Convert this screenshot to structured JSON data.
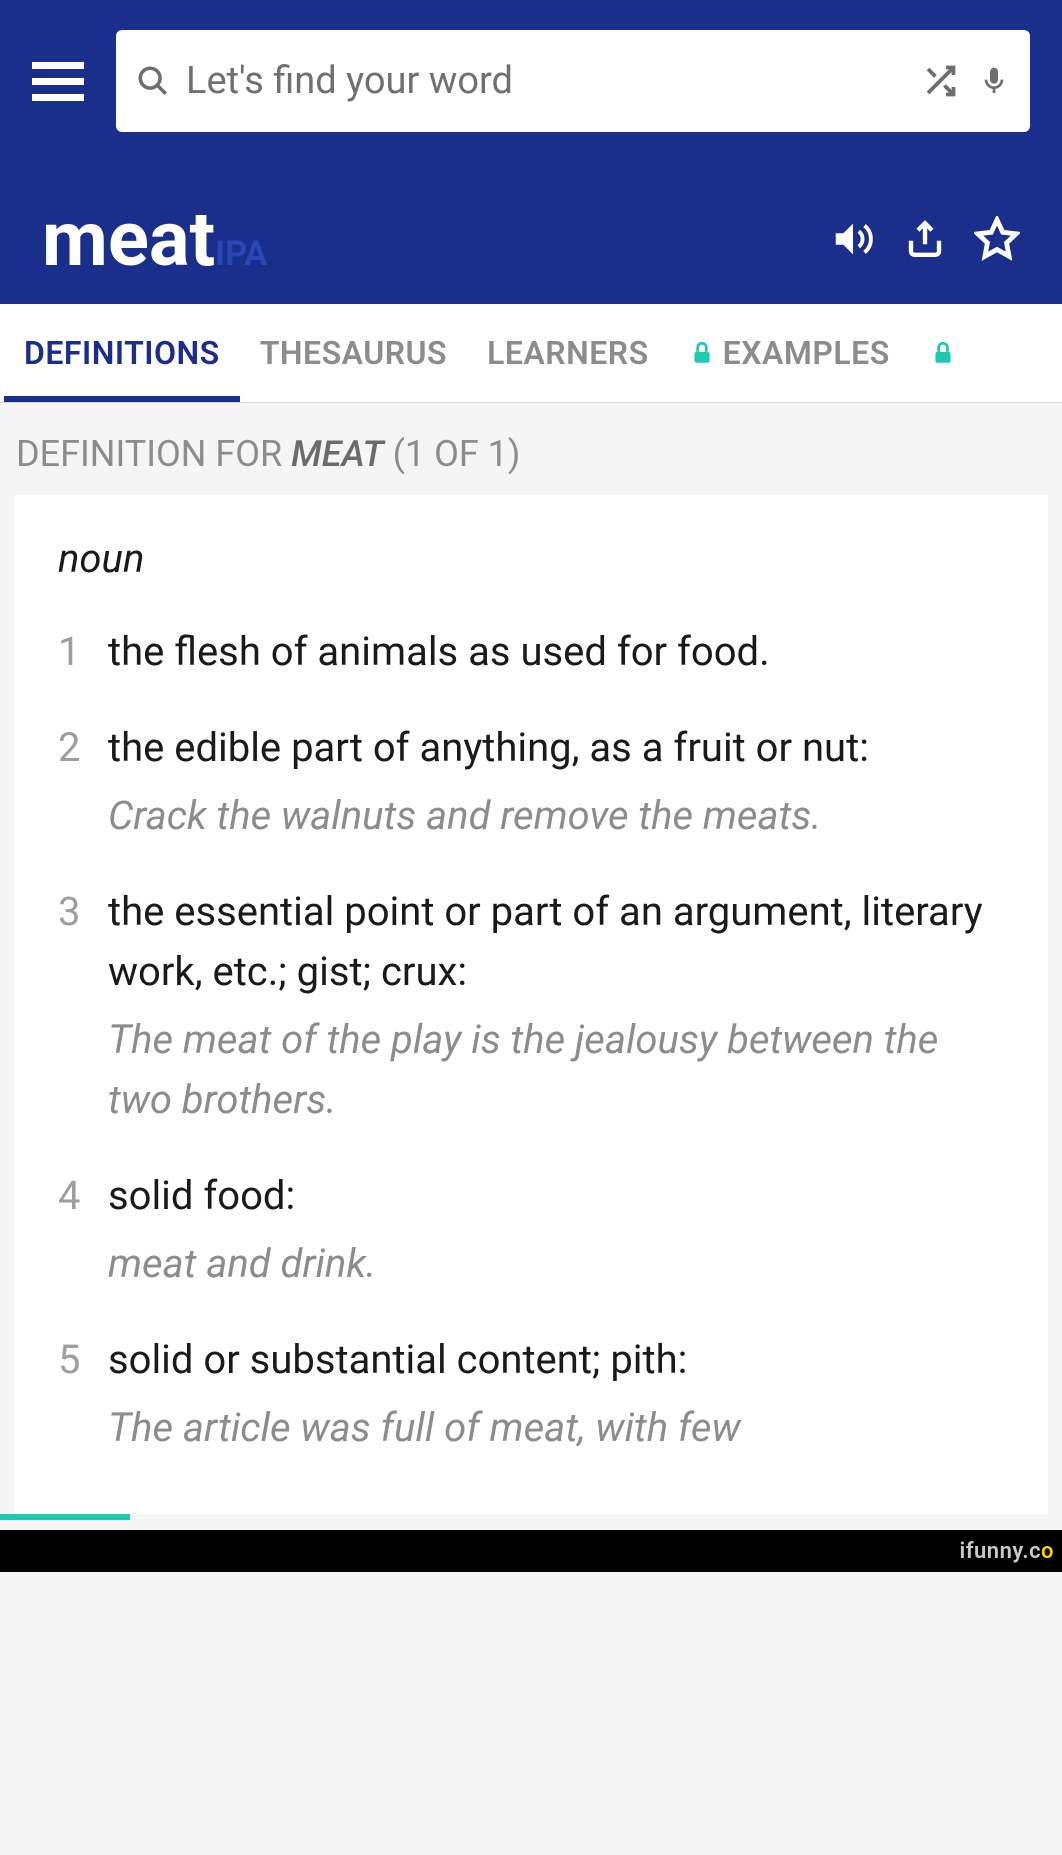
{
  "search": {
    "placeholder": "Let's find your word"
  },
  "word": {
    "headword": "meat",
    "ipa_label": "IPA"
  },
  "tabs": {
    "definitions": "DEFINITIONS",
    "thesaurus": "THESAURUS",
    "learners": "LEARNERS",
    "examples": "EXAMPLES"
  },
  "section": {
    "prefix": "DEFINITION FOR ",
    "word": "MEAT",
    "count": " (1 OF 1)"
  },
  "entry": {
    "pos": "noun",
    "defs": [
      {
        "num": "1",
        "text": "the flesh of animals as used for food.",
        "example": ""
      },
      {
        "num": "2",
        "text": "the edible part of anything, as a fruit or nut:",
        "example": "Crack the walnuts and remove the meats."
      },
      {
        "num": "3",
        "text": "the essential point or part of an argument, literary work, etc.; gist; crux:",
        "example": "The meat of the play is the jealousy between the two brothers."
      },
      {
        "num": "4",
        "text": "solid food:",
        "example": "meat and drink."
      },
      {
        "num": "5",
        "text": "solid or substantial content; pith:",
        "example": "The article was full of meat, with few"
      }
    ]
  },
  "watermark": {
    "text": "ifunny.c",
    "suffix": "o"
  }
}
